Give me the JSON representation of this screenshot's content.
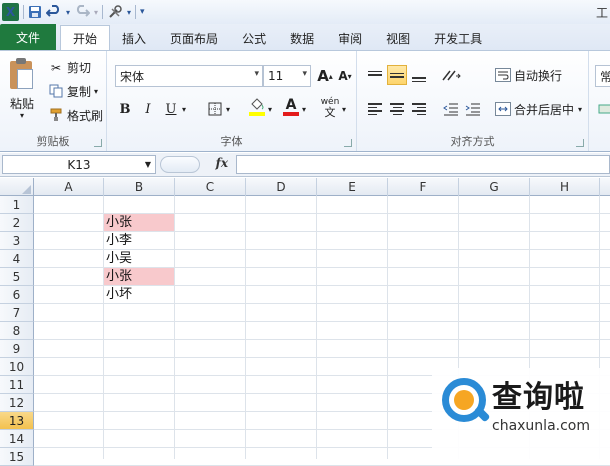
{
  "qat": {
    "logo": "X",
    "title_fragment": "工"
  },
  "tabs": [
    {
      "label": "文件"
    },
    {
      "label": "开始"
    },
    {
      "label": "插入"
    },
    {
      "label": "页面布局"
    },
    {
      "label": "公式"
    },
    {
      "label": "数据"
    },
    {
      "label": "审阅"
    },
    {
      "label": "视图"
    },
    {
      "label": "开发工具"
    }
  ],
  "ribbon": {
    "clipboard": {
      "paste": "粘贴",
      "cut": "剪切",
      "copy": "复制",
      "format_painter": "格式刷",
      "group_label": "剪贴板"
    },
    "font": {
      "font_name": "宋体",
      "font_size": "11",
      "bold": "B",
      "italic": "I",
      "underline": "U",
      "grow": "A",
      "shrink": "A",
      "font_color_letter": "A",
      "wen": "wén",
      "group_label": "字体"
    },
    "alignment": {
      "wrap_text": "自动换行",
      "merge_center": "合并后居中",
      "group_label": "对齐方式"
    },
    "number": {
      "partial": "常"
    }
  },
  "formula_bar": {
    "name_box": "K13",
    "fx": "fx",
    "value": ""
  },
  "sheet": {
    "columns": [
      "A",
      "B",
      "C",
      "D",
      "E",
      "F",
      "G",
      "H"
    ],
    "rows": [
      "1",
      "2",
      "3",
      "4",
      "5",
      "6",
      "7",
      "8",
      "9",
      "10",
      "11",
      "12",
      "13",
      "14",
      "15"
    ],
    "selected_row": "13",
    "highlight_color": "#f8c9cc",
    "cells": {
      "B2": "小张",
      "B3": "小李",
      "B4": "小吴",
      "B5": "小张",
      "B6": "小坏"
    }
  },
  "watermark": {
    "text": "查询啦",
    "url": "chaxunla.com"
  }
}
